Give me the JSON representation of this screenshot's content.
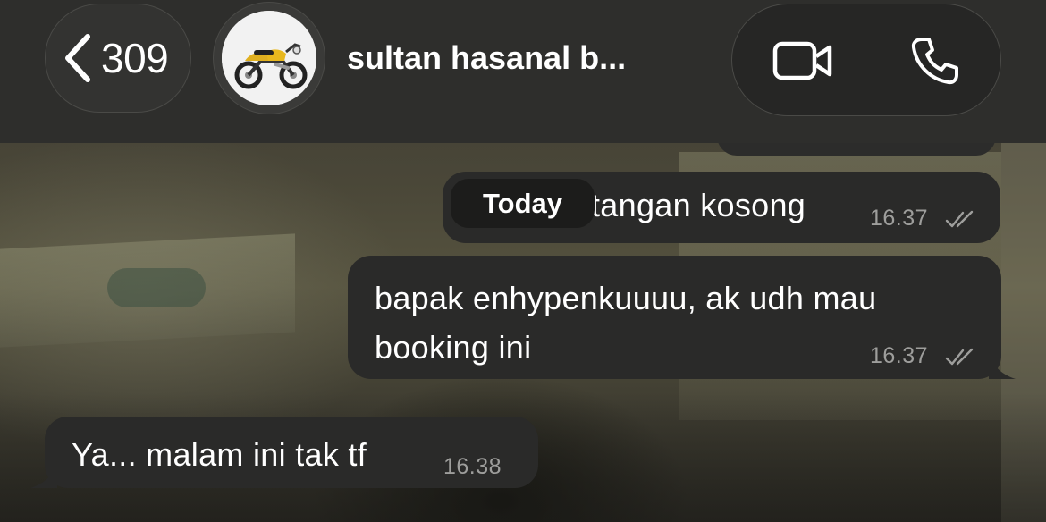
{
  "header": {
    "back_count": "309",
    "contact_name": "sultan hasanal b...",
    "icons": [
      "chevron-left-icon",
      "video-call-icon",
      "phone-call-icon"
    ]
  },
  "date_chip": "Today",
  "messages": [
    {
      "direction": "outgoing",
      "text": "tangan kosong",
      "time": "16.37",
      "status": "read"
    },
    {
      "direction": "outgoing",
      "text": "bapak enhypenkuuuu, ak udh mau booking ini",
      "time": "16.37",
      "status": "read"
    },
    {
      "direction": "incoming",
      "text": "Ya... malam ini tak tf",
      "time": "16.38"
    }
  ],
  "colors": {
    "header_bg": "#2e2e2c",
    "bubble_bg": "#2a2a29",
    "timestamp": "#9e9e9c"
  }
}
